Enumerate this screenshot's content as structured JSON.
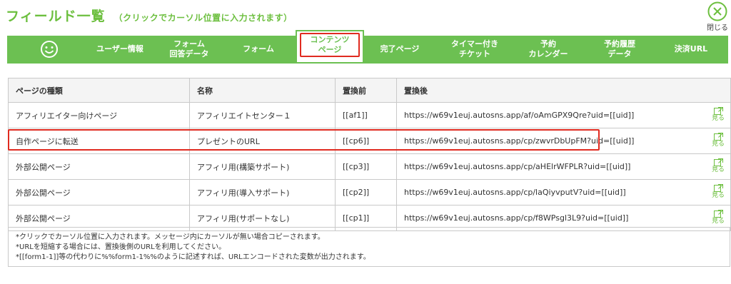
{
  "header": {
    "title": "フィールド一覧",
    "subtitle": "（クリックでカーソル位置に入力されます）",
    "close_label": "閉じる"
  },
  "tabs": [
    {
      "label": ""
    },
    {
      "label": "ユーザー情報"
    },
    {
      "label": "フォーム\n回答データ"
    },
    {
      "label": "フォーム"
    },
    {
      "label": "コンテンツ\nページ"
    },
    {
      "label": "完了ページ"
    },
    {
      "label": "タイマー付き\nチケット"
    },
    {
      "label": "予約\nカレンダー"
    },
    {
      "label": "予約履歴\nデータ"
    },
    {
      "label": "決済URL"
    }
  ],
  "table": {
    "headers": [
      "ページの種類",
      "名称",
      "置換前",
      "置換後"
    ],
    "view_label": "見る",
    "rows": [
      {
        "type": "アフィリエイター向けページ",
        "name": "アフィリエイトセンター１",
        "code": "[[af1]]",
        "url": "https://w69v1euj.autosns.app/af/oAmGPX9Qre?uid=[[uid]]"
      },
      {
        "type": "自作ページに転送",
        "name": "プレゼントのURL",
        "code": "[[cp6]]",
        "url": "https://w69v1euj.autosns.app/cp/zwvrDbUpFM?uid=[[uid]]"
      },
      {
        "type": "外部公開ページ",
        "name": "アフィリ用(構築サポート)",
        "code": "[[cp3]]",
        "url": "https://w69v1euj.autosns.app/cp/aHElrWFPLR?uid=[[uid]]"
      },
      {
        "type": "外部公開ページ",
        "name": "アフィリ用(導入サポート)",
        "code": "[[cp2]]",
        "url": "https://w69v1euj.autosns.app/cp/laQiyvputV?uid=[[uid]]"
      },
      {
        "type": "外部公開ページ",
        "name": "アフィリ用(サポートなし)",
        "code": "[[cp1]]",
        "url": "https://w69v1euj.autosns.app/cp/f8WPsgl3L9?uid=[[uid]]"
      }
    ]
  },
  "notes": [
    "*クリックでカーソル位置に入力されます。メッセージ内にカーソルが無い場合コピーされます。",
    "*URLを短縮する場合には、置換後側のURLを利用してください。",
    "*[[form1-1]]等の代わりに%%form1-1%%のように記述すれば、URLエンコードされた変数が出力されます。"
  ],
  "colors": {
    "accent_green": "#6cc052",
    "highlight_red": "#e02b20",
    "affiliate_pink": "#e27aa0"
  },
  "icons": [
    "smiley-icon",
    "close-circle-icon",
    "external-link-icon"
  ]
}
